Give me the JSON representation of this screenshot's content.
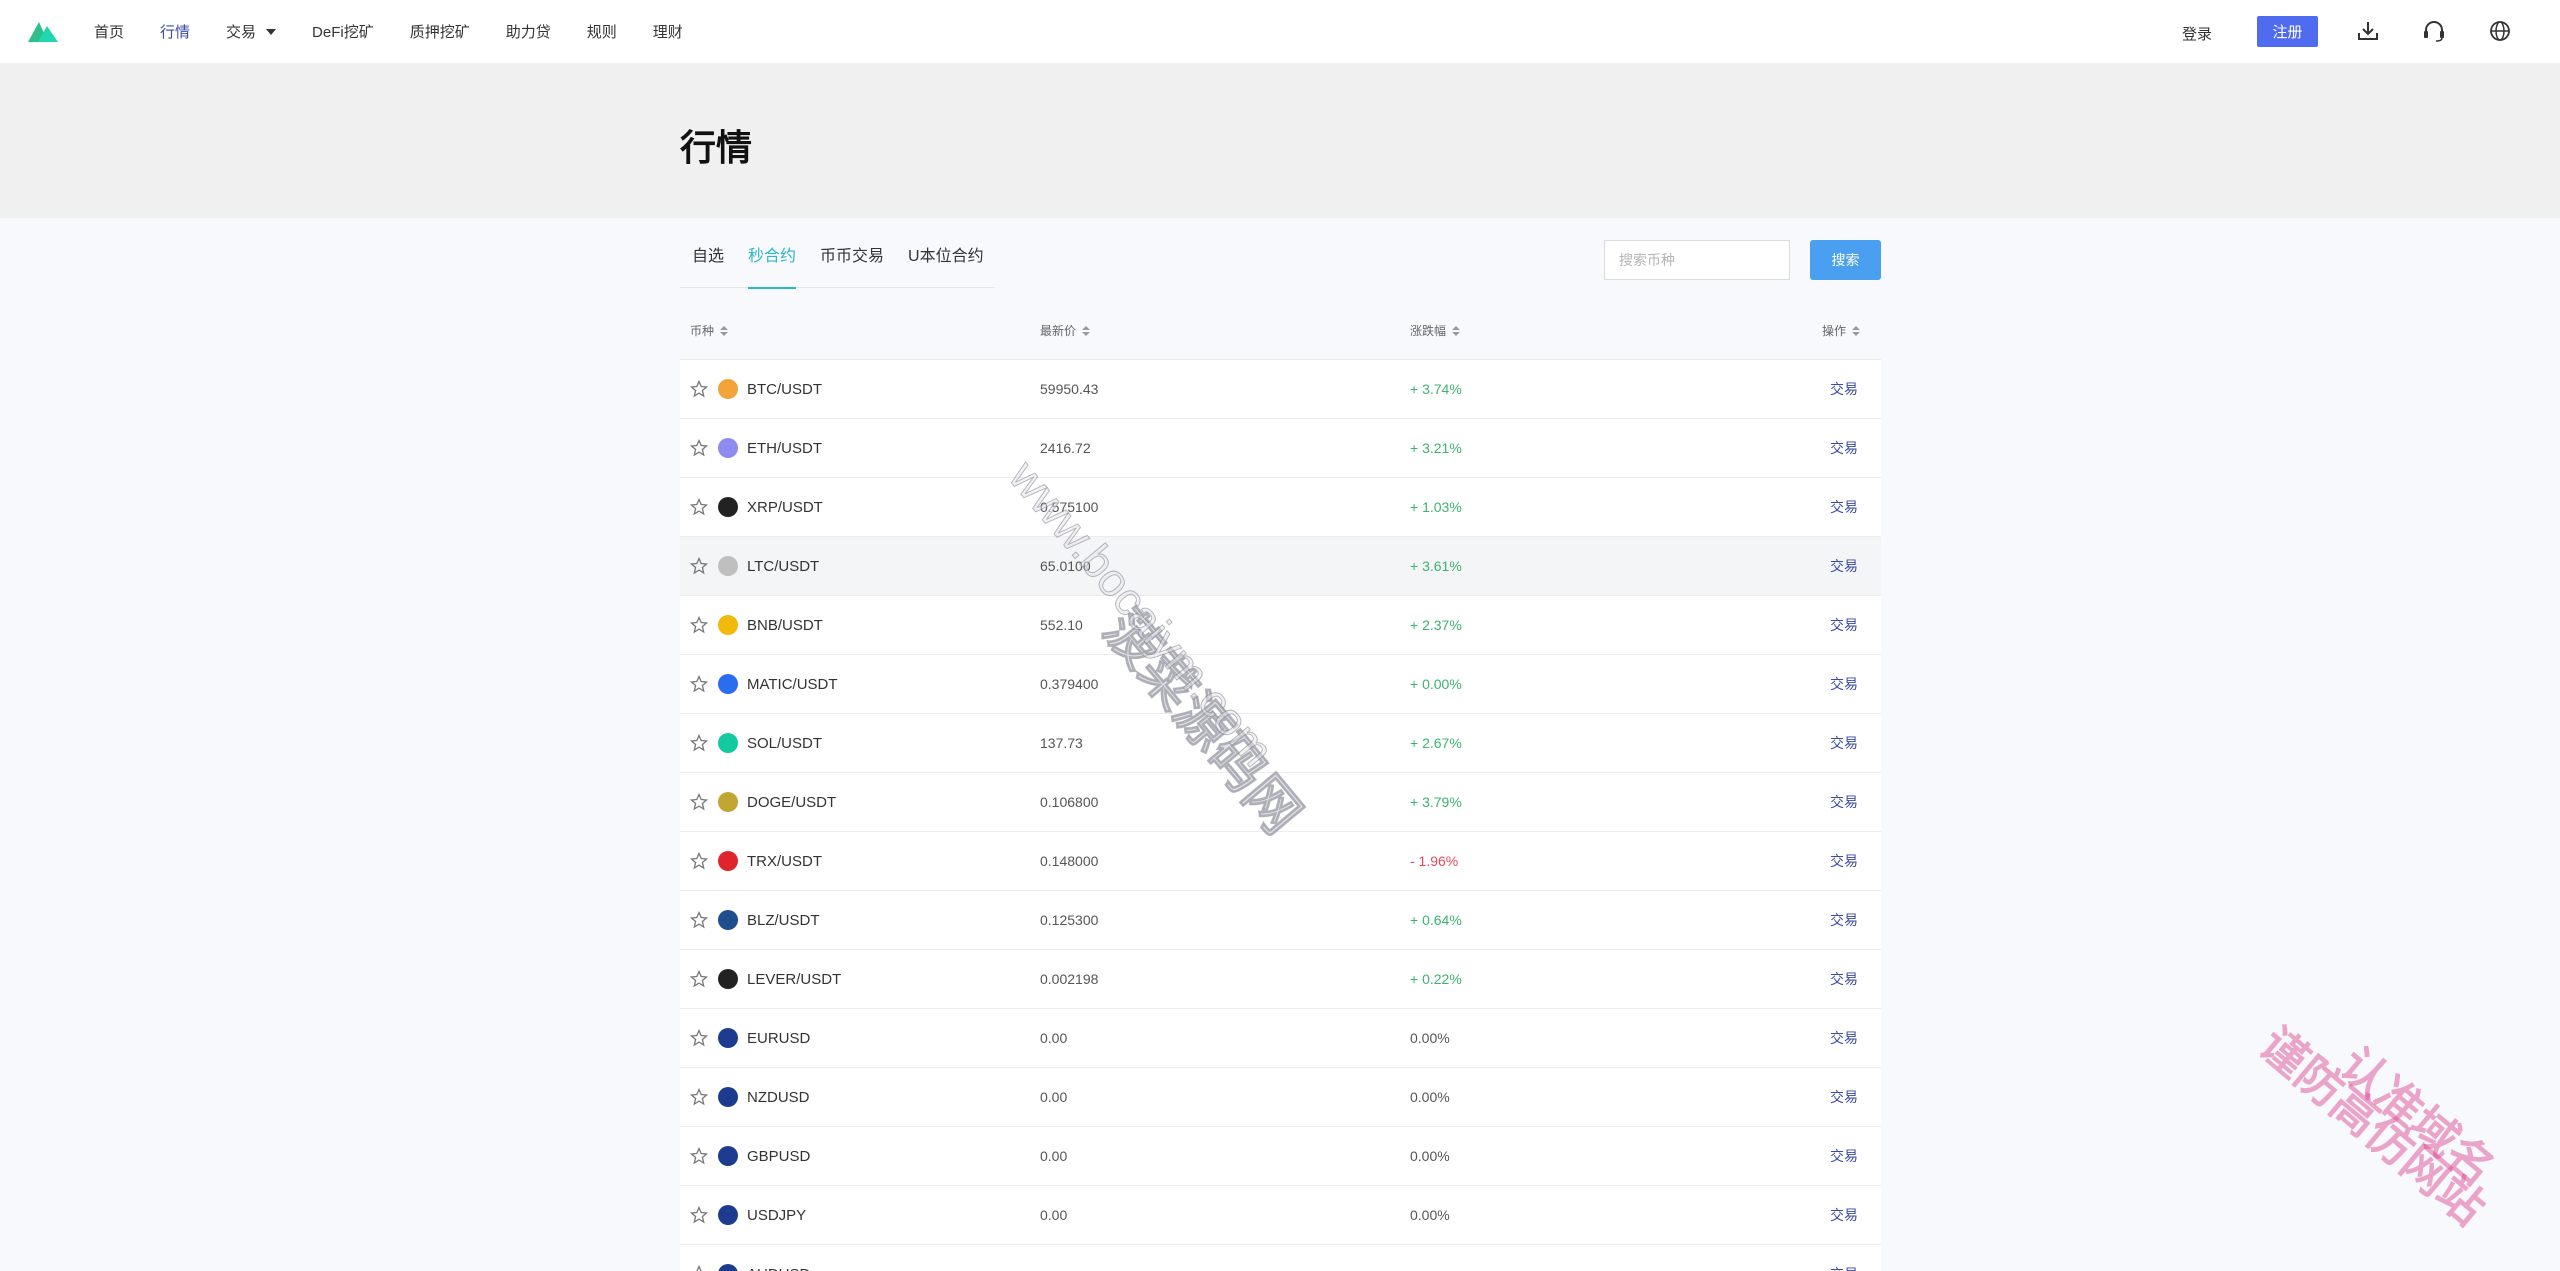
{
  "header": {
    "nav": [
      "首页",
      "行情",
      "交易",
      "DeFi挖矿",
      "质押挖矿",
      "助力贷",
      "规则",
      "理财"
    ],
    "active_nav": "行情",
    "login_label": "登录",
    "register_label": "注册",
    "icons": [
      "download-icon",
      "headset-icon",
      "globe-icon"
    ]
  },
  "page": {
    "title": "行情"
  },
  "tabs": [
    "自选",
    "秒合约",
    "币币交易",
    "U本位合约"
  ],
  "active_tab": "秒合约",
  "search": {
    "placeholder": "搜索币种",
    "button_label": "搜索"
  },
  "table": {
    "headers": [
      "币种",
      "最新价",
      "涨跌幅",
      "操作"
    ],
    "rows": [
      {
        "pair": "BTC/USDT",
        "price": "59950.43",
        "change": "+ 3.74%",
        "dir": "up",
        "coin_color": "#f2a33a",
        "coin_icon": "bitcoin-icon"
      },
      {
        "pair": "ETH/USDT",
        "price": "2416.72",
        "change": "+ 3.21%",
        "dir": "up",
        "coin_color": "#8c8cf0",
        "coin_icon": "ethereum-icon"
      },
      {
        "pair": "XRP/USDT",
        "price": "0.575100",
        "change": "+ 1.03%",
        "dir": "up",
        "coin_color": "#222222",
        "coin_icon": "xrp-icon"
      },
      {
        "pair": "LTC/USDT",
        "price": "65.0100",
        "change": "+ 3.61%",
        "dir": "up",
        "coin_color": "#bfbfbf",
        "coin_icon": "litecoin-icon"
      },
      {
        "pair": "BNB/USDT",
        "price": "552.10",
        "change": "+ 2.37%",
        "dir": "up",
        "coin_color": "#f0b90b",
        "coin_icon": "bnb-icon"
      },
      {
        "pair": "MATIC/USDT",
        "price": "0.379400",
        "change": "+ 0.00%",
        "dir": "up",
        "coin_color": "#2b6def",
        "coin_icon": "matic-icon"
      },
      {
        "pair": "SOL/USDT",
        "price": "137.73",
        "change": "+ 2.67%",
        "dir": "up",
        "coin_color": "#14c9a0",
        "coin_icon": "solana-icon"
      },
      {
        "pair": "DOGE/USDT",
        "price": "0.106800",
        "change": "+ 3.79%",
        "dir": "up",
        "coin_color": "#c2a633",
        "coin_icon": "doge-icon"
      },
      {
        "pair": "TRX/USDT",
        "price": "0.148000",
        "change": "- 1.96%",
        "dir": "down",
        "coin_color": "#e0242c",
        "coin_icon": "tron-icon"
      },
      {
        "pair": "BLZ/USDT",
        "price": "0.125300",
        "change": "+ 0.64%",
        "dir": "up",
        "coin_color": "#1f4e8c",
        "coin_icon": "bluzelle-icon"
      },
      {
        "pair": "LEVER/USDT",
        "price": "0.002198",
        "change": "+ 0.22%",
        "dir": "up",
        "coin_color": "#222222",
        "coin_icon": "lever-icon"
      },
      {
        "pair": "EURUSD",
        "price": "0.00",
        "change": "0.00%",
        "dir": "zero",
        "coin_color": "#1d3c8f",
        "coin_icon": "eu-flag-icon"
      },
      {
        "pair": "NZDUSD",
        "price": "0.00",
        "change": "0.00%",
        "dir": "zero",
        "coin_color": "#1d3c8f",
        "coin_icon": "nz-flag-icon"
      },
      {
        "pair": "GBPUSD",
        "price": "0.00",
        "change": "0.00%",
        "dir": "zero",
        "coin_color": "#1d3c8f",
        "coin_icon": "uk-flag-icon"
      },
      {
        "pair": "USDJPY",
        "price": "0.00",
        "change": "0.00%",
        "dir": "zero",
        "coin_color": "#1d3c8f",
        "coin_icon": "us-flag-icon"
      },
      {
        "pair": "AUDUSD",
        "price": "",
        "change": "",
        "dir": "zero",
        "coin_color": "#1d3c8f",
        "coin_icon": "au-flag-icon"
      }
    ],
    "highlighted_row": 3,
    "trade_label": "交易"
  },
  "watermarks": {
    "center_cn": "菠菜源码网",
    "center_url": "www.bocaiym.com",
    "corner_line1": "认准域名",
    "corner_line2": "谨防高仿网站"
  },
  "colors": {
    "accent": "#4f6bf0",
    "tab_active": "#2bb5c8",
    "up": "#3cb371",
    "down": "#e04c5c",
    "link": "#3b4aa8"
  }
}
